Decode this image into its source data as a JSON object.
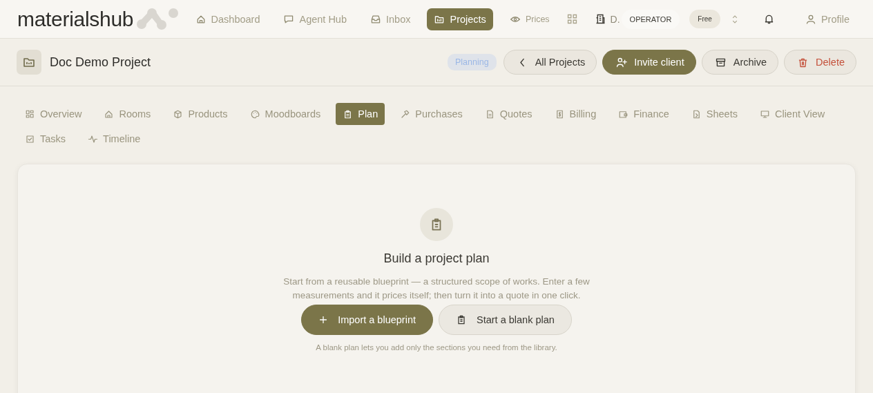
{
  "brand": "materialshub",
  "nav": [
    {
      "label": "Dashboard",
      "selected": false
    },
    {
      "label": "Agent Hub",
      "selected": false
    },
    {
      "label": "Inbox",
      "selected": false
    },
    {
      "label": "Projects",
      "selected": true
    },
    {
      "label": "Prices",
      "selected": false
    }
  ],
  "workspace": "D.",
  "role_badge": "OPERATOR",
  "plan_badge": "Free",
  "profile": "Profile",
  "project": {
    "title": "Doc Demo Project",
    "status": "Planning"
  },
  "actions": [
    {
      "label": "All Projects",
      "kind": "back"
    },
    {
      "label": "Invite client",
      "kind": "primary"
    },
    {
      "label": "Archive",
      "kind": "archive"
    },
    {
      "label": "Delete",
      "kind": "danger"
    }
  ],
  "tabs": [
    {
      "label": "Overview",
      "selected": false
    },
    {
      "label": "Rooms",
      "selected": false
    },
    {
      "label": "Products",
      "selected": false
    },
    {
      "label": "Moodboards",
      "selected": false
    },
    {
      "label": "Plan",
      "selected": true
    },
    {
      "label": "Purchases",
      "selected": false
    },
    {
      "label": "Quotes",
      "selected": false
    },
    {
      "label": "Billing",
      "selected": false
    },
    {
      "label": "Finance",
      "selected": false
    },
    {
      "label": "Sheets",
      "selected": false
    },
    {
      "label": "Client View",
      "selected": false
    },
    {
      "label": "Tasks",
      "selected": false
    },
    {
      "label": "Timeline",
      "selected": false
    }
  ],
  "empty_state": {
    "title": "Build a project plan",
    "description": "Start from a reusable blueprint — a structured scope of works. Enter a few measurements and it prices itself; then turn it into a quote in one click.",
    "buttons": [
      {
        "label": "Import a blueprint",
        "kind": "primary"
      },
      {
        "label": "Start a blank plan",
        "kind": "secondary"
      }
    ],
    "hint": "A blank plan lets you add only the sections you need from the library."
  }
}
